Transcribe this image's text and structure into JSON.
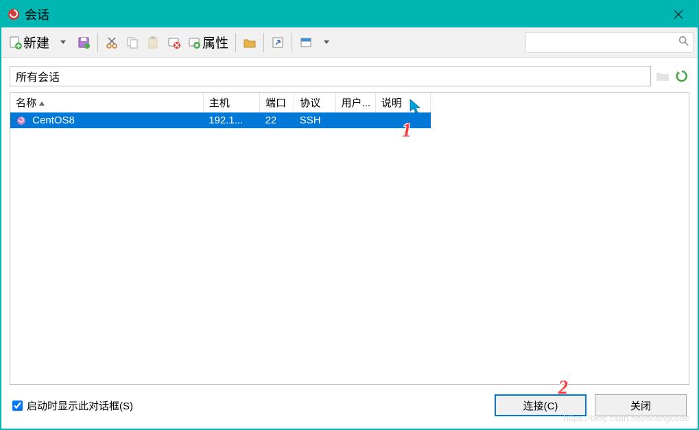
{
  "window": {
    "title": "会话"
  },
  "toolbar": {
    "new_label": "新建",
    "props_label": "属性"
  },
  "search": {
    "placeholder": ""
  },
  "path": {
    "value": "所有会话"
  },
  "columns": {
    "name": "名称",
    "host": "主机",
    "port": "端口",
    "protocol": "协议",
    "user": "用户...",
    "desc": "说明"
  },
  "rows": [
    {
      "name": "CentOS8",
      "host": "192.1...",
      "port": "22",
      "protocol": "SSH",
      "user": "",
      "desc": ""
    }
  ],
  "footer": {
    "show_at_startup": "启动时显示此对话框(S)",
    "connect": "连接(C)",
    "close": "关闭"
  },
  "annotations": {
    "one": "1",
    "two": "2"
  },
  "watermark": "https://blog.csdn.net/shangcode"
}
